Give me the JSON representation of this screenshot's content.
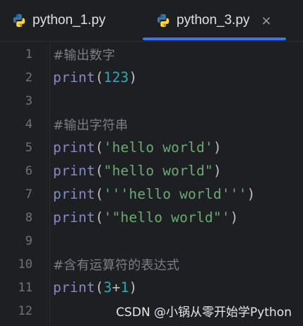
{
  "tabs": [
    {
      "label": "python_1.py",
      "icon": "python-icon",
      "active": false
    },
    {
      "label": "python_3.py",
      "icon": "python-icon",
      "active": true,
      "close": "×"
    }
  ],
  "lines": [
    {
      "num": "1",
      "comment": "#输出数字"
    },
    {
      "num": "2",
      "fn": "print",
      "open": "(",
      "arg": "123",
      "close": ")"
    },
    {
      "num": "3"
    },
    {
      "num": "4",
      "comment": "#输出字符串"
    },
    {
      "num": "5",
      "fn": "print",
      "open": "(",
      "arg": "'hello world'",
      "close": ")"
    },
    {
      "num": "6",
      "fn": "print",
      "open": "(",
      "arg": "\"hello world\"",
      "close": ")"
    },
    {
      "num": "7",
      "fn": "print",
      "open": "(",
      "arg": "'''hello world'''",
      "close": ")"
    },
    {
      "num": "8",
      "fn": "print",
      "open": "(",
      "arg": "'\"hello world\"'",
      "close": ")"
    },
    {
      "num": "9"
    },
    {
      "num": "10",
      "comment": "#含有运算符的表达式"
    },
    {
      "num": "11",
      "fn": "print",
      "open": "(",
      "arg_a": "3",
      "operator": "+",
      "arg_b": "1",
      "close": ")"
    },
    {
      "num": "12"
    }
  ],
  "watermark": "CSDN @小锅从零开始学Python",
  "colors": {
    "background": "#1e1f22",
    "keyword": "#8888c6",
    "number": "#2aacb8",
    "string": "#6aab73",
    "comment": "#7a7e85",
    "accent": "#3574f0"
  }
}
